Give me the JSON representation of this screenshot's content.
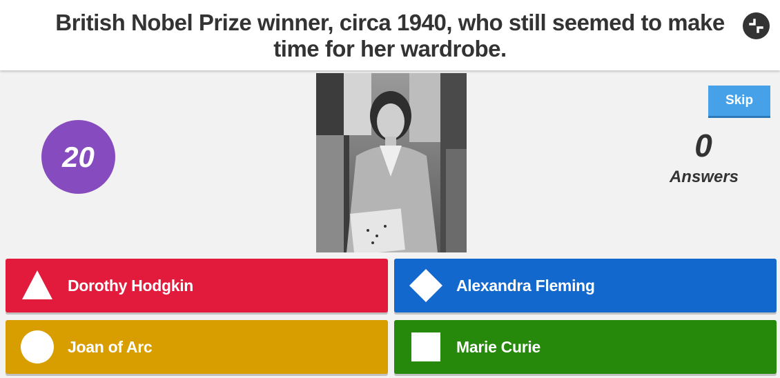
{
  "question": {
    "text": "British Nobel Prize winner, circa 1940, who still seemed to make time for her wardrobe."
  },
  "timer": {
    "seconds": "20"
  },
  "skip_label": "Skip",
  "answers_count": "0",
  "answers_label": "Answers",
  "answers": [
    {
      "shape": "triangle-icon",
      "label": "Dorothy Hodgkin",
      "color": "#e21b3c"
    },
    {
      "shape": "diamond-icon",
      "label": "Alexandra Fleming",
      "color": "#1368ce"
    },
    {
      "shape": "circle-icon",
      "label": "Joan of Arc",
      "color": "#d89e00"
    },
    {
      "shape": "square-icon",
      "label": "Marie Curie",
      "color": "#26890c"
    }
  ],
  "colors": {
    "timer": "#864cbf",
    "skip": "#46a1e8"
  }
}
